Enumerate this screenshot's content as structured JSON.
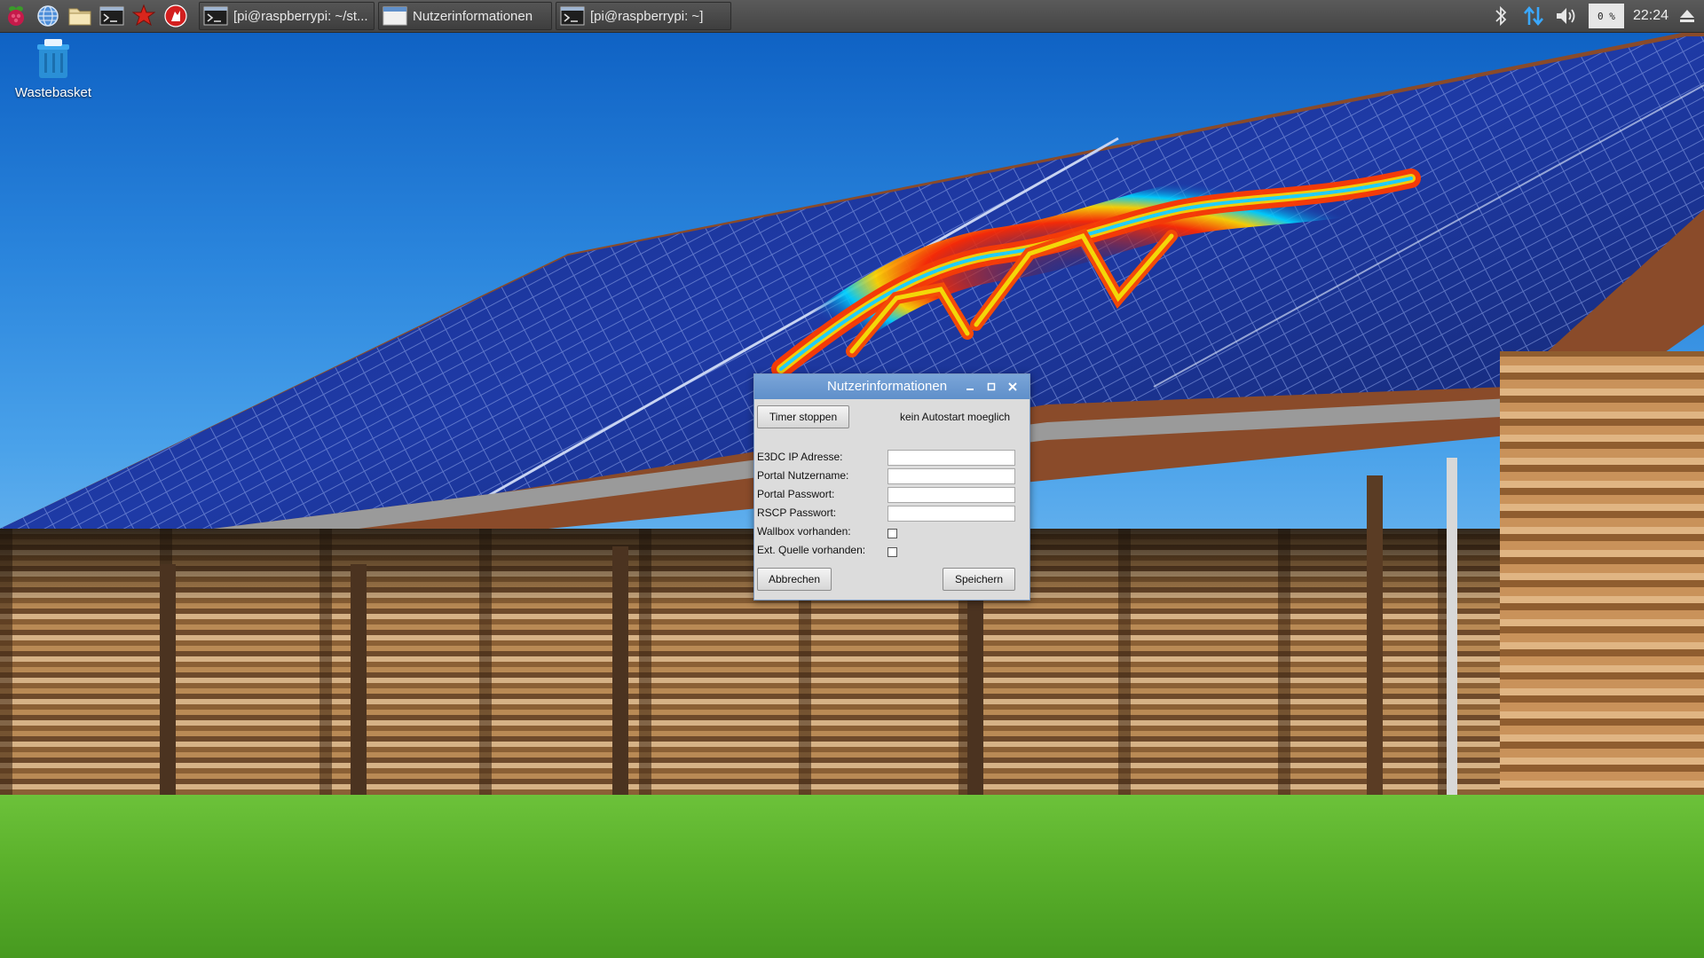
{
  "taskbar": {
    "launchers": [
      {
        "name": "raspberry-menu-icon"
      },
      {
        "name": "web-browser-icon"
      },
      {
        "name": "file-manager-icon"
      },
      {
        "name": "terminal-icon"
      },
      {
        "name": "mathematica-icon"
      },
      {
        "name": "wolfram-icon"
      }
    ],
    "tasks": [
      {
        "label": "[pi@raspberrypi: ~/st...",
        "icon": "terminal-icon"
      },
      {
        "label": "Nutzerinformationen",
        "icon": "window-icon"
      },
      {
        "label": "[pi@raspberrypi: ~]",
        "icon": "terminal-icon"
      }
    ],
    "tray": {
      "cpu": "0 %",
      "clock": "22:24"
    }
  },
  "desktop": {
    "icons": [
      {
        "label": "Wastebasket"
      }
    ]
  },
  "dialog": {
    "title": "Nutzerinformationen",
    "timer_button": "Timer stoppen",
    "autostart_status": "kein Autostart moeglich",
    "fields": [
      {
        "label": "E3DC IP Adresse:",
        "value": ""
      },
      {
        "label": "Portal Nutzername:",
        "value": ""
      },
      {
        "label": "Portal Passwort:",
        "value": ""
      },
      {
        "label": "RSCP Passwort:",
        "value": ""
      }
    ],
    "checkboxes": [
      {
        "label": "Wallbox vorhanden:",
        "checked": false
      },
      {
        "label": "Ext. Quelle vorhanden:",
        "checked": false
      }
    ],
    "cancel_button": "Abbrechen",
    "save_button": "Speichern"
  },
  "colors": {
    "taskbar": "#454545",
    "dialog_title": "#5f8fca",
    "dialog_bg": "#dcdcdc",
    "sky": "#2b86dd"
  }
}
